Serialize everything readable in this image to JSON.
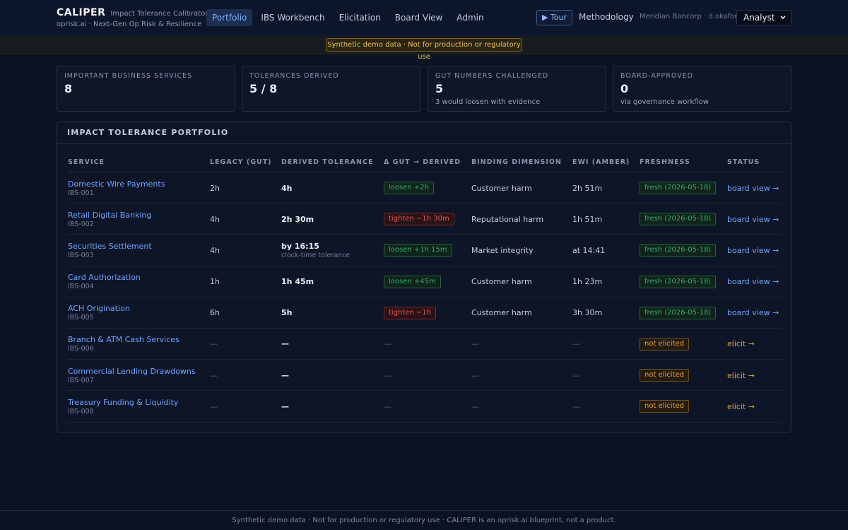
{
  "header": {
    "brand": "CALIPER",
    "brand_sub": "Impact Tolerance Calibrator",
    "brand_line": "oprisk.ai · Next-Gen Op Risk & Resilience",
    "nav": [
      "Portfolio",
      "IBS Workbench",
      "Elicitation",
      "Board View",
      "Admin"
    ],
    "active_nav": "Portfolio",
    "tour_label": "▶ Tour",
    "methodology_label": "Methodology",
    "org": "Meridian Bancorp · d.okafor ·",
    "role_value": "Analyst",
    "role_chevron": "chevron-down-icon"
  },
  "banner": "Synthetic demo data · Not for production or regulatory use",
  "stats": [
    {
      "label": "IMPORTANT BUSINESS SERVICES",
      "value": "8",
      "note": ""
    },
    {
      "label": "TOLERANCES DERIVED",
      "value": "5 / 8",
      "note": ""
    },
    {
      "label": "GUT NUMBERS CHALLENGED",
      "value": "5",
      "note": "3 would loosen with evidence"
    },
    {
      "label": "BOARD-APPROVED",
      "value": "0",
      "note": "via governance workflow"
    }
  ],
  "portfolio": {
    "title": "IMPACT TOLERANCE PORTFOLIO",
    "columns": [
      "SERVICE",
      "LEGACY (GUT)",
      "DERIVED TOLERANCE",
      "Δ GUT → DERIVED",
      "BINDING DIMENSION",
      "EWI (AMBER)",
      "FRESHNESS",
      "STATUS"
    ],
    "rows": [
      {
        "name": "Domestic Wire Payments",
        "id": "IBS-001",
        "legacy": "2h",
        "derived": "4h",
        "derived_sub": "",
        "delta": "loosen +2h",
        "delta_kind": "loosen",
        "binding": "Customer harm",
        "ewi": "2h 51m",
        "fresh": "fresh (2026-05-18)",
        "fresh_kind": "fresh",
        "status": "board view →",
        "status_kind": "blue"
      },
      {
        "name": "Retail Digital Banking",
        "id": "IBS-002",
        "legacy": "4h",
        "derived": "2h 30m",
        "derived_sub": "",
        "delta": "tighten −1h 30m",
        "delta_kind": "tighten",
        "binding": "Reputational harm",
        "ewi": "1h 51m",
        "fresh": "fresh (2026-05-18)",
        "fresh_kind": "fresh",
        "status": "board view →",
        "status_kind": "blue"
      },
      {
        "name": "Securities Settlement",
        "id": "IBS-003",
        "legacy": "4h",
        "derived": "by 16:15",
        "derived_sub": "clock-time tolerance",
        "delta": "loosen +1h 15m",
        "delta_kind": "loosen",
        "binding": "Market integrity",
        "ewi": "at 14:41",
        "fresh": "fresh (2026-05-18)",
        "fresh_kind": "fresh",
        "status": "board view →",
        "status_kind": "blue"
      },
      {
        "name": "Card Authorization",
        "id": "IBS-004",
        "legacy": "1h",
        "derived": "1h 45m",
        "derived_sub": "",
        "delta": "loosen +45m",
        "delta_kind": "loosen",
        "binding": "Customer harm",
        "ewi": "1h 23m",
        "fresh": "fresh (2026-05-18)",
        "fresh_kind": "fresh",
        "status": "board view →",
        "status_kind": "blue"
      },
      {
        "name": "ACH Origination",
        "id": "IBS-005",
        "legacy": "6h",
        "derived": "5h",
        "derived_sub": "",
        "delta": "tighten −1h",
        "delta_kind": "tighten",
        "binding": "Customer harm",
        "ewi": "3h 30m",
        "fresh": "fresh (2026-05-18)",
        "fresh_kind": "fresh",
        "status": "board view →",
        "status_kind": "blue"
      },
      {
        "name": "Branch & ATM Cash Services",
        "id": "IBS-006",
        "legacy": "—",
        "derived": "—",
        "derived_sub": "",
        "delta": "—",
        "delta_kind": "none",
        "binding": "—",
        "ewi": "—",
        "fresh": "not elicited",
        "fresh_kind": "notel",
        "status": "elicit →",
        "status_kind": "amber"
      },
      {
        "name": "Commercial Lending Drawdowns",
        "id": "IBS-007",
        "legacy": "—",
        "derived": "—",
        "derived_sub": "",
        "delta": "—",
        "delta_kind": "none",
        "binding": "—",
        "ewi": "—",
        "fresh": "not elicited",
        "fresh_kind": "notel",
        "status": "elicit →",
        "status_kind": "amber"
      },
      {
        "name": "Treasury Funding & Liquidity",
        "id": "IBS-008",
        "legacy": "—",
        "derived": "—",
        "derived_sub": "",
        "delta": "—",
        "delta_kind": "none",
        "binding": "—",
        "ewi": "—",
        "fresh": "not elicited",
        "fresh_kind": "notel",
        "status": "elicit →",
        "status_kind": "amber"
      }
    ]
  },
  "footer": "Synthetic demo data · Not for production or regulatory use · CALIPER is an oprisk.ai blueprint, not a product."
}
